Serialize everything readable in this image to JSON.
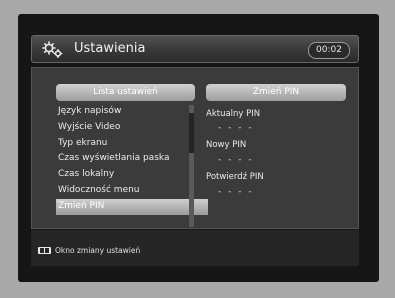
{
  "header": {
    "icon": "gear-icon",
    "title": "Ustawienia",
    "clock": "00:02"
  },
  "settings_list": {
    "header": "Lista ustawień",
    "items": [
      "Język napisów",
      "Wyjście Video",
      "Typ ekranu",
      "Czas wyświetlania paska",
      "Czas lokalny",
      "Widoczność menu",
      "Zmień PIN"
    ],
    "selected": "Zmień PIN"
  },
  "pin_panel": {
    "header": "Zmień PIN",
    "fields": [
      {
        "label": "Aktualny PIN",
        "value": "- - - -"
      },
      {
        "label": "Nowy PIN",
        "value": "- - - -"
      },
      {
        "label": "Potwierdź PIN",
        "value": "- - - -"
      }
    ]
  },
  "footer": {
    "key_icon": "ok-key-icon",
    "hint": "Okno zmiany ustawień"
  },
  "colors": {
    "background": "#161616",
    "panel": "#3b3b3b",
    "highlight": "#bdbdbd"
  }
}
